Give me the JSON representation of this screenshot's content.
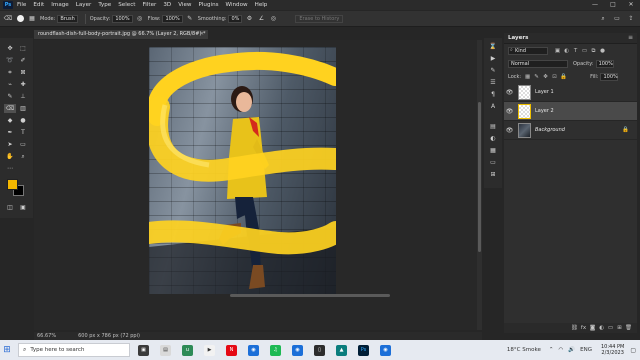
{
  "menubar": {
    "logo": "Ps",
    "items": [
      "File",
      "Edit",
      "Image",
      "Layer",
      "Type",
      "Select",
      "Filter",
      "3D",
      "View",
      "Plugins",
      "Window",
      "Help"
    ],
    "window_controls": [
      "—",
      "□",
      "✕"
    ]
  },
  "options_bar": {
    "mode_label": "Mode:",
    "mode_value": "Brush",
    "opacity_label": "Opacity:",
    "opacity_value": "100%",
    "flow_label": "Flow:",
    "flow_value": "100%",
    "smoothing_label": "Smoothing:",
    "smoothing_value": "0%",
    "erase_history": "Erase to History"
  },
  "document": {
    "tab_title": "roundflash-dish-full-body-portrait.jpg @ 66.7% (Layer 2, RGB/8#) *",
    "close_glyph": "✕"
  },
  "statusbar": {
    "zoom": "66.67%",
    "doc_size": "600 px x 786 px (72 ppi)"
  },
  "layers_panel": {
    "title": "Layers",
    "menu_glyph": "≡",
    "kind_label": "Kind",
    "blend_mode": "Normal",
    "opacity_label": "Opacity:",
    "opacity_value": "100%",
    "lock_label": "Lock:",
    "fill_label": "Fill:",
    "fill_value": "100%",
    "layers": [
      {
        "name": "Layer 1",
        "thumb": "transparent",
        "active": false
      },
      {
        "name": "Layer 2",
        "thumb": "transparent",
        "active": true
      },
      {
        "name": "Background",
        "thumb": "photo",
        "active": false
      }
    ]
  },
  "taskbar": {
    "search_placeholder": "Type here to search",
    "weather": "18°C  Smoke",
    "language": "ENG",
    "time": "10:44 PM",
    "date": "2/3/2023"
  },
  "colors": {
    "foreground": "#f5b800",
    "background": "#000000",
    "stroke_yellow": "#ffd21f",
    "photoshop_blue": "#31a8ff"
  }
}
